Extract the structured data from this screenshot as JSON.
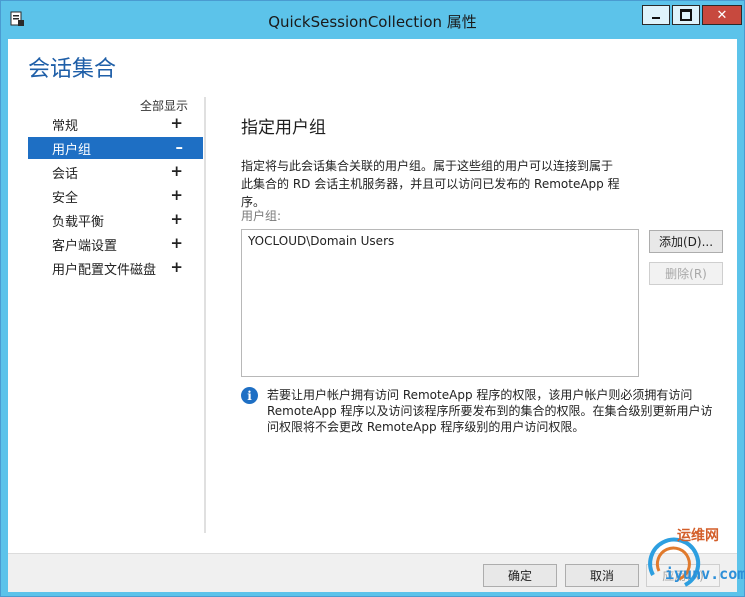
{
  "window": {
    "title": "QuickSessionCollection 属性"
  },
  "header": {
    "heading": "会话集合"
  },
  "nav": {
    "show_all": "全部显示",
    "items": [
      {
        "label": "常规",
        "toggle": "+"
      },
      {
        "label": "用户组",
        "toggle": "–"
      },
      {
        "label": "会话",
        "toggle": "+"
      },
      {
        "label": "安全",
        "toggle": "+"
      },
      {
        "label": "负载平衡",
        "toggle": "+"
      },
      {
        "label": "客户端设置",
        "toggle": "+"
      },
      {
        "label": "用户配置文件磁盘",
        "toggle": "+"
      }
    ]
  },
  "content": {
    "title": "指定用户组",
    "description": "指定将与此会话集合关联的用户组。属于这些组的用户可以连接到属于此集合的 RD 会话主机服务器，并且可以访问已发布的 RemoteApp 程序。",
    "field_label": "用户组:",
    "groups": [
      "YOCLOUD\\Domain Users"
    ],
    "add_button": "添加(D)...",
    "remove_button": "删除(R)",
    "info_icon": "i",
    "info_text": "若要让用户帐户拥有访问 RemoteApp 程序的权限，该用户帐户则必须拥有访问 RemoteApp 程序以及访问该程序所要发布到的集合的权限。在集合级别更新用户访问权限将不会更改 RemoteApp 程序级别的用户访问权限。"
  },
  "footer": {
    "ok": "确定",
    "cancel": "取消",
    "apply": "应用(A)"
  },
  "watermark": {
    "cn": "运维网",
    "en": "iyunv.com"
  }
}
